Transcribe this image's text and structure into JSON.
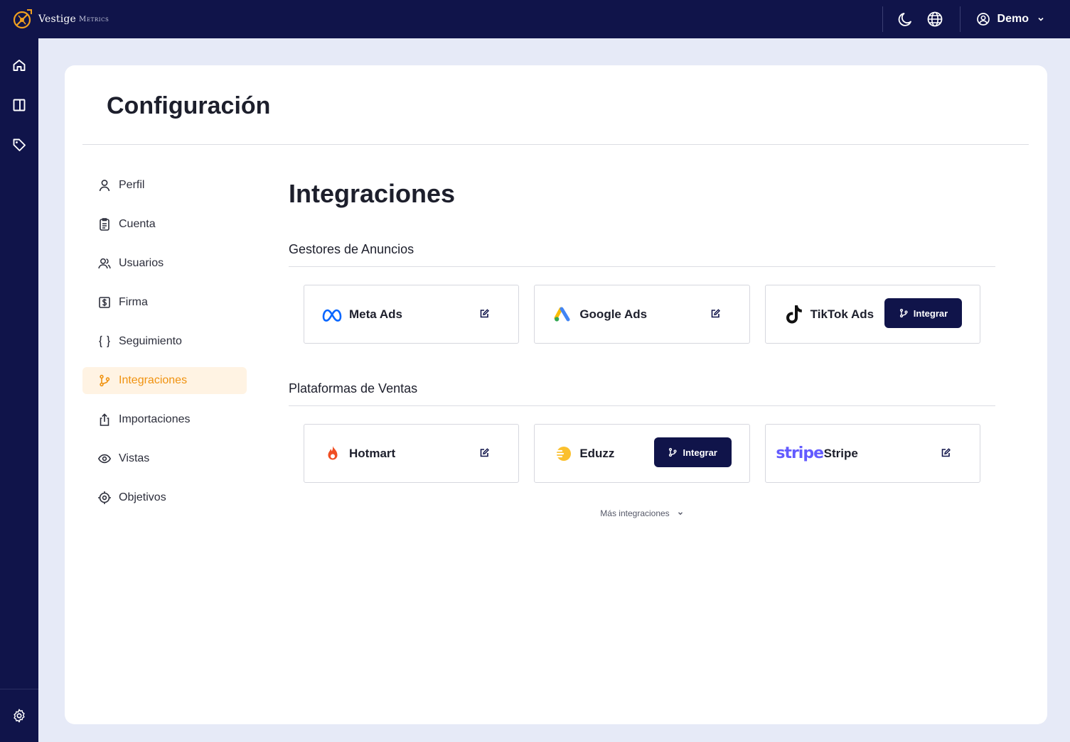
{
  "brand": {
    "name": "Vestige",
    "sub": "Metrics",
    "logo_icon": "compass-logo"
  },
  "topbar": {
    "theme_icon": "moon-icon",
    "language_icon": "globe-icon",
    "user": {
      "name": "Demo",
      "icon": "user-circle-icon"
    }
  },
  "rail": {
    "items": [
      "home-icon",
      "panel-icon",
      "tag-icon"
    ],
    "bottom": "gear-icon"
  },
  "page": {
    "title": "Configuración"
  },
  "sidenav": {
    "items": [
      {
        "label": "Perfil",
        "icon": "user-icon"
      },
      {
        "label": "Cuenta",
        "icon": "clipboard-icon"
      },
      {
        "label": "Usuarios",
        "icon": "users-icon"
      },
      {
        "label": "Firma",
        "icon": "dollar-square-icon"
      },
      {
        "label": "Seguimiento",
        "icon": "braces-icon"
      },
      {
        "label": "Integraciones",
        "icon": "branch-icon",
        "active": true
      },
      {
        "label": "Importaciones",
        "icon": "upload-icon"
      },
      {
        "label": "Vistas",
        "icon": "eye-icon"
      },
      {
        "label": "Objetivos",
        "icon": "target-icon"
      }
    ]
  },
  "integrations": {
    "title": "Integraciones",
    "ads_group": {
      "title": "Gestores de Anuncios",
      "tiles": [
        {
          "name": "Meta Ads",
          "logo": "meta-logo",
          "action": "edit"
        },
        {
          "name": "Google Ads",
          "logo": "google-ads-logo",
          "action": "edit"
        },
        {
          "name": "TikTok Ads",
          "logo": "tiktok-logo",
          "action": "integrate",
          "button_label": "Integrar"
        }
      ]
    },
    "sales_group": {
      "title": "Plataformas de Ventas",
      "tiles": [
        {
          "name": "Hotmart",
          "logo": "hotmart-logo",
          "action": "edit"
        },
        {
          "name": "Eduzz",
          "logo": "eduzz-logo",
          "action": "integrate",
          "button_label": "Integrar"
        },
        {
          "name": "Stripe",
          "logo": "stripe-logo",
          "logo_text": "stripe",
          "action": "edit"
        }
      ]
    },
    "more_label": "Más integraciones"
  },
  "colors": {
    "navy": "#10144a",
    "accent": "#f0920f",
    "accent_bg": "#fff3e3",
    "meta_blue": "#0866ff",
    "stripe_purple": "#635bff",
    "hotmart_orange": "#f04e23",
    "eduzz_yellow": "#fbc02d"
  }
}
